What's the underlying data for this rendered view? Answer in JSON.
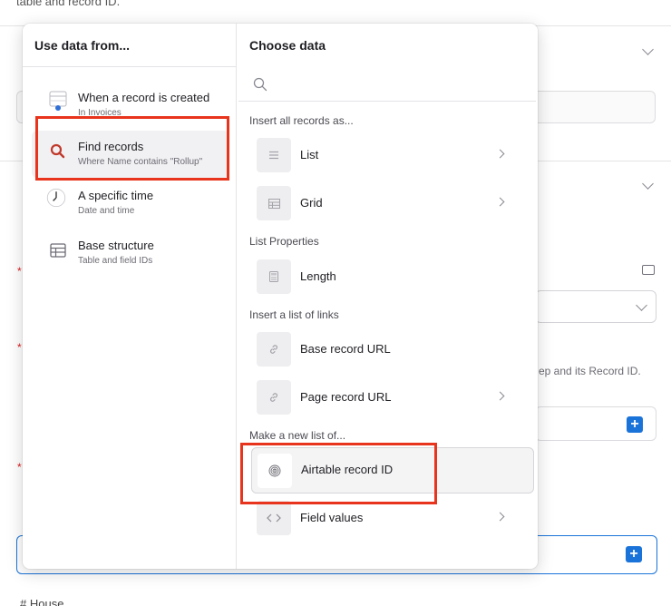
{
  "background": {
    "top_text": "table and record ID.",
    "right_hint_text": "ep and its Record ID.",
    "house_text": "House"
  },
  "source_panel": {
    "header": "Use data from...",
    "items": [
      {
        "title": "When a record is created",
        "subtitle": "In Invoices",
        "icon": "record-created-icon"
      },
      {
        "title": "Find records",
        "subtitle": "Where Name contains \"Rollup\"",
        "icon": "search-icon",
        "selected": true
      },
      {
        "title": "A specific time",
        "subtitle": "Date and time",
        "icon": "clock-icon"
      },
      {
        "title": "Base structure",
        "subtitle": "Table and field IDs",
        "icon": "table-icon"
      }
    ]
  },
  "data_panel": {
    "header": "Choose data",
    "search_placeholder": "",
    "sections": {
      "insert_all": "Insert all records as...",
      "list_properties": "List Properties",
      "insert_links": "Insert a list of links",
      "make_new_list": "Make a new list of..."
    },
    "options": {
      "list": "List",
      "grid": "Grid",
      "length": "Length",
      "base_record_url": "Base record URL",
      "page_record_url": "Page record URL",
      "airtable_record_id": "Airtable record ID",
      "field_values": "Field values"
    }
  },
  "colors": {
    "accent_blue": "#1a73d9",
    "annotation_red": "#e8341c",
    "selected_bg": "#f1f1f3"
  }
}
